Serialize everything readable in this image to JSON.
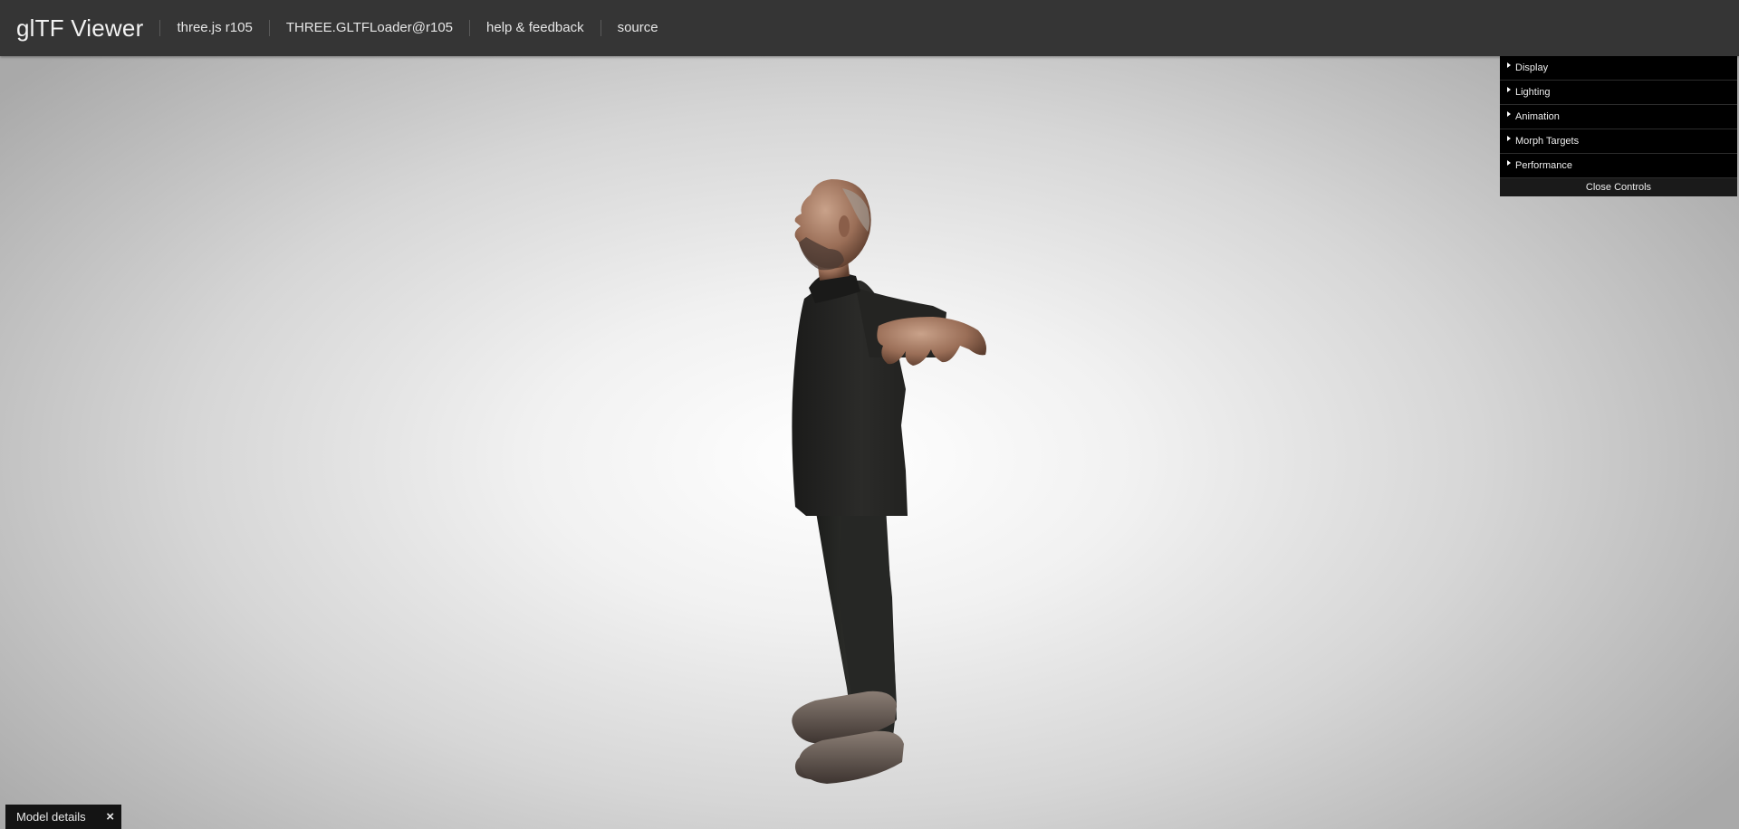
{
  "header": {
    "title": "glTF Viewer",
    "nav": [
      {
        "label": "three.js r105"
      },
      {
        "label": "THREE.GLTFLoader@r105"
      },
      {
        "label": "help & feedback"
      },
      {
        "label": "source"
      }
    ]
  },
  "controls": {
    "folders": [
      {
        "label": "Display"
      },
      {
        "label": "Lighting"
      },
      {
        "label": "Animation"
      },
      {
        "label": "Morph Targets"
      },
      {
        "label": "Performance"
      }
    ],
    "close_label": "Close Controls"
  },
  "model_details": {
    "label": "Model details",
    "close_icon": "×"
  },
  "colors": {
    "header_bg": "#353535",
    "panel_bg": "#000000"
  }
}
